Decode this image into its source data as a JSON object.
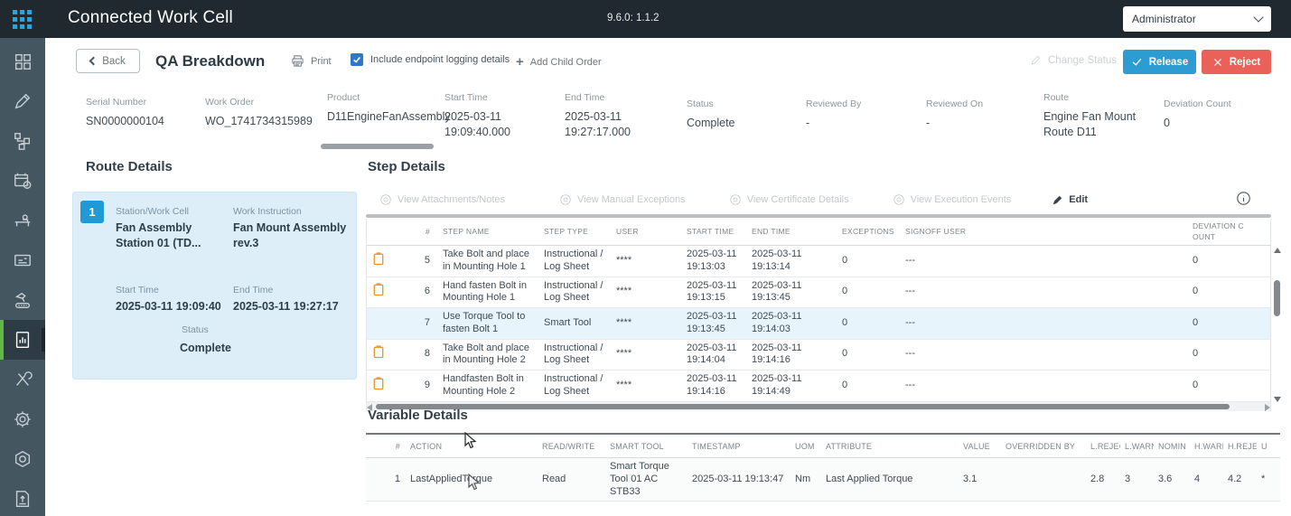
{
  "topbar": {
    "title": "Connected Work Cell",
    "version": "9.6.0: 1.1.2",
    "user_menu": "Administrator"
  },
  "sidebar": {
    "icons": [
      "dashboard-grid",
      "edit-pencil",
      "workflow",
      "schedule-calendar",
      "operator-workstation",
      "production-card",
      "robot-arm",
      "qa-report",
      "maintenance-tools",
      "settings-gear",
      "package-hexagon",
      "document-upload"
    ],
    "active_icon": "qa-report"
  },
  "actionbar": {
    "back": "Back",
    "title": "QA Breakdown",
    "print": "Print",
    "logging_checkbox": "Include endpoint logging details",
    "add_child_order": "Add Child Order",
    "change_status": "Change Status",
    "release": "Release",
    "reject": "Reject"
  },
  "summary": {
    "fields": [
      {
        "label": "Serial Number",
        "value": "SN0000000104"
      },
      {
        "label": "Work Order",
        "value": "WO_1741734315989"
      },
      {
        "label": "Product",
        "value": "D11EngineFanAssembly"
      },
      {
        "label": "Start Time",
        "value": "2025-03-11 19:09:40.000"
      },
      {
        "label": "End Time",
        "value": "2025-03-11 19:27:17.000"
      },
      {
        "label": "Status",
        "value": "Complete"
      },
      {
        "label": "Reviewed By",
        "value": "-"
      },
      {
        "label": "Reviewed On",
        "value": "-"
      },
      {
        "label": "Route",
        "value": "Engine Fan Mount Route D11"
      },
      {
        "label": "Deviation Count",
        "value": "0"
      }
    ]
  },
  "route_details": {
    "heading": "Route Details",
    "step_number": "1",
    "station_label": "Station/Work Cell",
    "station_value": "Fan Assembly Station 01 (TD...",
    "work_instruction_label": "Work Instruction",
    "work_instruction_value": "Fan Mount Assembly rev.3",
    "start_time_label": "Start Time",
    "start_time_value": "2025-03-11 19:09:40",
    "end_time_label": "End Time",
    "end_time_value": "2025-03-11 19:27:17",
    "status_label": "Status",
    "status_value": "Complete"
  },
  "step_details": {
    "heading": "Step Details",
    "toolbar": {
      "view_attachments": "View Attachments/Notes",
      "view_manual_exceptions": "View Manual Exceptions",
      "view_certificate_details": "View Certificate Details",
      "view_execution_events": "View Execution Events",
      "edit": "Edit"
    },
    "columns": [
      "#",
      "STEP NAME",
      "STEP TYPE",
      "USER",
      "START TIME",
      "END TIME",
      "EXCEPTIONS",
      "SIGNOFF USER",
      "DEVIATION COUNT"
    ],
    "rows": [
      {
        "num": "5",
        "name": "Take Bolt and place in Mounting Hole 1",
        "type": "Instructional / Log Sheet",
        "user": "****",
        "start": "2025-03-11 19:13:03",
        "end": "2025-03-11 19:13:14",
        "exceptions": "0",
        "signoff": "---",
        "deviation": "0"
      },
      {
        "num": "6",
        "name": "Hand fasten Bolt in Mounting Hole 1",
        "type": "Instructional / Log Sheet",
        "user": "****",
        "start": "2025-03-11 19:13:15",
        "end": "2025-03-11 19:13:45",
        "exceptions": "0",
        "signoff": "---",
        "deviation": "0"
      },
      {
        "num": "7",
        "name": "Use Torque Tool to fasten Bolt 1",
        "type": "Smart Tool",
        "user": "****",
        "start": "2025-03-11 19:13:45",
        "end": "2025-03-11 19:14:03",
        "exceptions": "0",
        "signoff": "---",
        "deviation": "0"
      },
      {
        "num": "8",
        "name": "Take Bolt and place in Mounting Hole 2",
        "type": "Instructional / Log Sheet",
        "user": "****",
        "start": "2025-03-11 19:14:04",
        "end": "2025-03-11 19:14:16",
        "exceptions": "0",
        "signoff": "---",
        "deviation": "0"
      },
      {
        "num": "9",
        "name": "Handfasten Bolt in Mounting Hole 2",
        "type": "Instructional / Log Sheet",
        "user": "****",
        "start": "2025-03-11 19:14:16",
        "end": "2025-03-11 19:14:49",
        "exceptions": "0",
        "signoff": "---",
        "deviation": "0"
      }
    ]
  },
  "variable_details": {
    "heading": "Variable Details",
    "columns": [
      "#",
      "ACTION",
      "READ/WRITE",
      "SMART TOOL",
      "TIMESTAMP",
      "UOM",
      "ATTRIBUTE",
      "VALUE",
      "OVERRIDDEN BY",
      "L.REJEC",
      "L.WARN",
      "NOMIN",
      "H.WARI",
      "H.REJEC",
      "U"
    ],
    "rows": [
      {
        "num": "1",
        "action": "LastAppliedTorque",
        "read_write": "Read",
        "smart_tool": "Smart Torque Tool 01 AC STB33",
        "timestamp": "2025-03-11 19:13:47",
        "uom": "Nm",
        "attribute": "Last Applied Torque",
        "value": "3.1",
        "overridden_by": "",
        "l_reject": "2.8",
        "l_warn": "3",
        "nominal": "3.6",
        "h_warn": "4",
        "h_reject": "4.2",
        "u": "*"
      }
    ]
  },
  "colors": {
    "topbar_bg": "#20292f",
    "sidebar_bg": "#44565f",
    "accent_blue": "#1f9ad6",
    "release_blue": "#2d9cd3",
    "reject_red": "#ea6159",
    "active_green": "#62b746",
    "note_orange": "#e8992e",
    "highlight_row": "#e8f4fb",
    "route_card_bg": "#ddeef8"
  }
}
